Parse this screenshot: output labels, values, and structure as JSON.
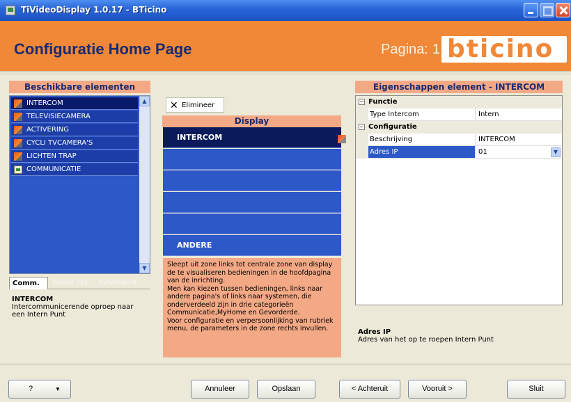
{
  "window": {
    "title": "TiVideoDisplay 1.0.17 - BTicino"
  },
  "header": {
    "title": "Configuratie Home Page",
    "pagina_label": "Pagina:",
    "pagina_number": "1",
    "logo_text": "bticino"
  },
  "left_panel": {
    "title": "Beschikbare elementen",
    "items": [
      {
        "label": "INTERCOM",
        "icon": "pen-icon",
        "selected": true
      },
      {
        "label": "TELEVISIECAMERA",
        "icon": "pen-icon",
        "selected": false
      },
      {
        "label": "ACTIVERING",
        "icon": "pen-icon",
        "selected": false
      },
      {
        "label": "CYCLI TVCAMERA'S",
        "icon": "pen-icon",
        "selected": false
      },
      {
        "label": "LICHTEN TRAP",
        "icon": "pen-icon",
        "selected": false
      },
      {
        "label": "COMMUNICATIE",
        "icon": "document-icon",
        "selected": false
      }
    ],
    "tabs": [
      "Comm.",
      "Home sys.",
      "Gevorderd"
    ],
    "desc_title": "INTERCOM",
    "desc_text": "Intercommunicerende oproep naar een Intern Punt"
  },
  "center": {
    "elimineer_label": "Elimineer",
    "display_title": "Display",
    "slots": [
      "INTERCOM",
      "",
      "",
      "",
      "",
      "ANDERE"
    ],
    "info": "Sleept uit zone links tot centrale zone van display de te visualiseren bedieningen in de hoofdpagina van de inrichting.\nMen kan kiezen tussen bedieningen, links naar andere pagina's of links naar systemen, die onderverdeeld zijn in drie categorieën Communicatie,MyHome en Gevorderde.\nVoor configuratie en verpersoonlijking van rubriek menu, de parameters in de zone rechts invullen."
  },
  "right_panel": {
    "title": "Eigenschappen element - INTERCOM",
    "cat1": "Functie",
    "cat2": "Configuratie",
    "rows": [
      {
        "name": "Type Intercom",
        "value": "Intern"
      },
      {
        "name": "Beschrijving",
        "value": "INTERCOM"
      },
      {
        "name": "Adres IP",
        "value": "01"
      }
    ],
    "desc_title": "Adres IP",
    "desc_text": "Adres van het op te roepen Intern Punt"
  },
  "footer": {
    "help": "?",
    "annuleer": "Annuleer",
    "opslaan": "Opslaan",
    "achteruit": "< Achteruit",
    "vooruit": "Vooruit >",
    "sluit": "Sluit"
  }
}
